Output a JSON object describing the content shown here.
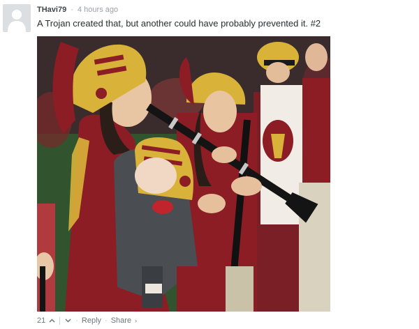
{
  "comment": {
    "username": "THavi79",
    "separator": "·",
    "timestamp": "4 hours ago",
    "text": "A Trojan created that, but another could have probably prevented it. #2",
    "image_alt": "Clarinet player in a cardinal and gold band uniform and knit helmet hat, carrying a sleeping baby in a carrier, with band members behind"
  },
  "footer": {
    "votes": "21",
    "upvote_icon": "chevron-up-icon",
    "downvote_icon": "chevron-down-icon",
    "reply_label": "Reply",
    "share_label": "Share",
    "share_icon": "chevron-right-icon",
    "dot": "·"
  },
  "colors": {
    "cardinal": "#8c1d24",
    "gold": "#d9b23a",
    "link_gray": "#6d757a"
  }
}
